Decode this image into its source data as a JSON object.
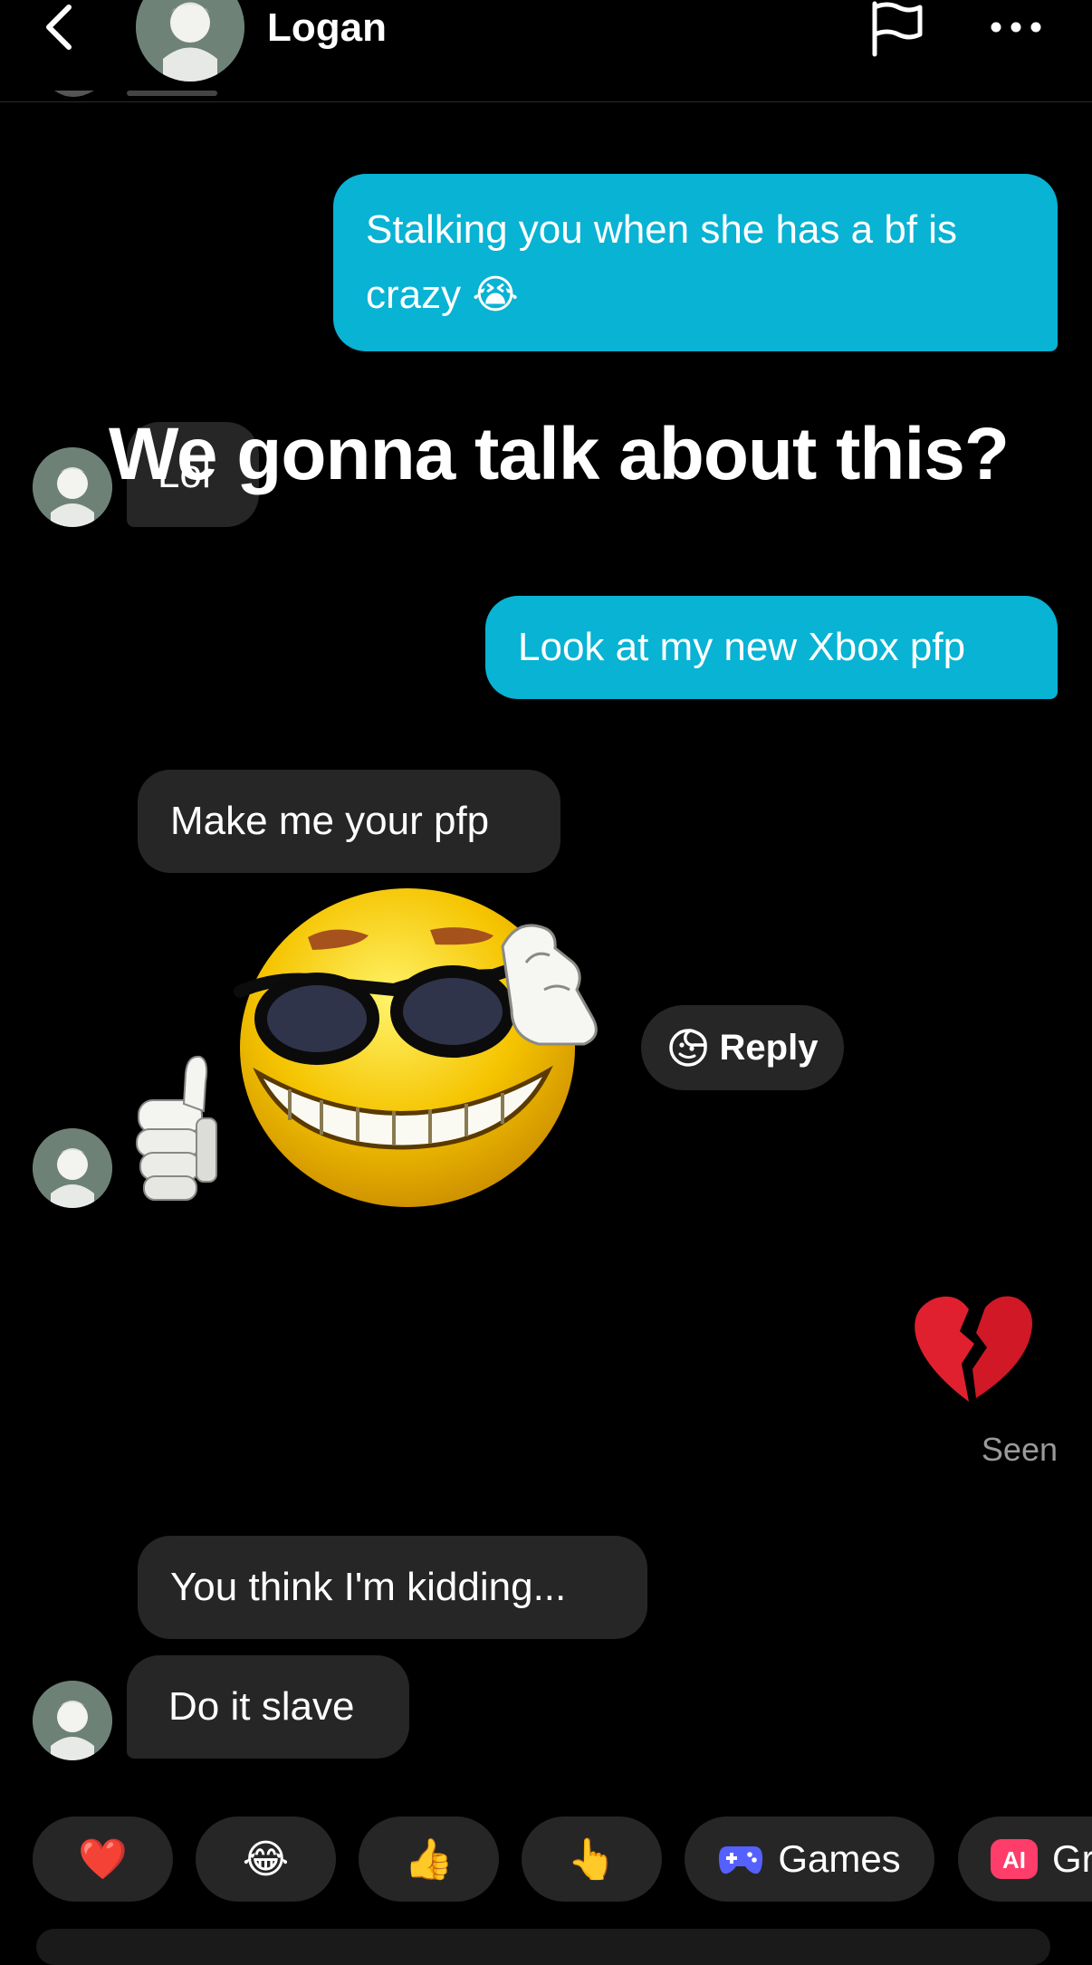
{
  "header": {
    "name": "Logan",
    "back_icon": "chevron-left-icon",
    "flag_icon": "flag-icon",
    "more_icon": "more-horizontal-icon"
  },
  "overlay_caption": "We gonna talk about this?",
  "messages": [
    {
      "side": "out",
      "text": "Stalking you when she has a bf is",
      "text2": "crazy 😭"
    },
    {
      "side": "in",
      "text": "Lol"
    },
    {
      "side": "out",
      "text": "Look at my new Xbox pfp"
    },
    {
      "side": "in",
      "text": "Make me your pfp"
    },
    {
      "side": "in",
      "type": "image",
      "image": "cool-emoji-sticker"
    },
    {
      "side": "out",
      "type": "emoji",
      "text": "💔"
    },
    {
      "side": "in",
      "text": "You think I'm kidding..."
    },
    {
      "side": "in",
      "text": "Do it slave"
    }
  ],
  "reply_button": {
    "label": "Reply",
    "icon": "sticker-face-icon"
  },
  "seen_label": "Seen",
  "quick_actions": [
    {
      "emoji": "❤️"
    },
    {
      "emoji": "😂"
    },
    {
      "emoji": "👍"
    },
    {
      "emoji": "👆"
    },
    {
      "icon": "gamepad-icon",
      "label": "Games"
    },
    {
      "icon": "ai-icon",
      "label": "Gr"
    }
  ],
  "colors": {
    "outgoing_bubble": "#08b3d4",
    "incoming_bubble": "#262626",
    "background": "#000000"
  }
}
